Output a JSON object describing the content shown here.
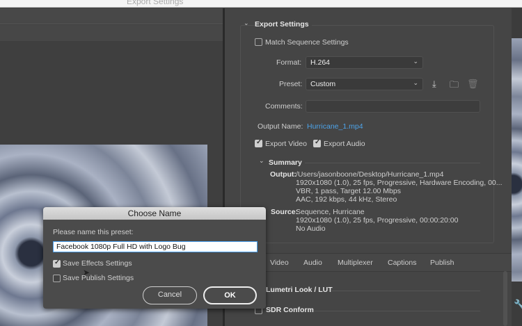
{
  "window": {
    "title": "Export Settings"
  },
  "export_settings": {
    "section_title": "Export Settings",
    "match_sequence": {
      "label": "Match Sequence Settings",
      "checked": false
    },
    "format": {
      "label": "Format:",
      "value": "H.264"
    },
    "preset": {
      "label": "Preset:",
      "value": "Custom"
    },
    "comments": {
      "label": "Comments:",
      "value": ""
    },
    "output_name": {
      "label": "Output Name:",
      "value": "Hurricane_1.mp4"
    },
    "export_video": {
      "label": "Export Video",
      "checked": true
    },
    "export_audio": {
      "label": "Export Audio",
      "checked": true
    },
    "summary": {
      "title": "Summary",
      "output_label": "Output:",
      "output_lines": [
        "/Users/jasonboone/Desktop/Hurricane_1.mp4",
        "1920x1080 (1.0), 25 fps, Progressive, Hardware Encoding, 00...",
        "VBR, 1 pass, Target 12.00 Mbps",
        "AAC, 192 kbps, 44 kHz, Stereo"
      ],
      "source_label": "Source:",
      "source_lines": [
        "Sequence, Hurricane",
        "1920x1080 (1.0), 25 fps, Progressive, 00:00:20:00",
        "No Audio"
      ]
    }
  },
  "tabs": [
    "Video",
    "Audio",
    "Multiplexer",
    "Captions",
    "Publish"
  ],
  "sections": [
    "Lumetri Look / LUT",
    "SDR Conform"
  ],
  "dialog": {
    "title": "Choose Name",
    "prompt": "Please name this preset:",
    "input_value": "Facebook 1080p Full HD with Logo Bug",
    "save_effects": {
      "label": "Save Effects Settings",
      "checked": true
    },
    "save_publish": {
      "label": "Save Publish Settings",
      "checked": false
    },
    "cancel": "Cancel",
    "ok": "OK"
  },
  "colors": {
    "link": "#4da3e8",
    "panel": "#454545"
  }
}
